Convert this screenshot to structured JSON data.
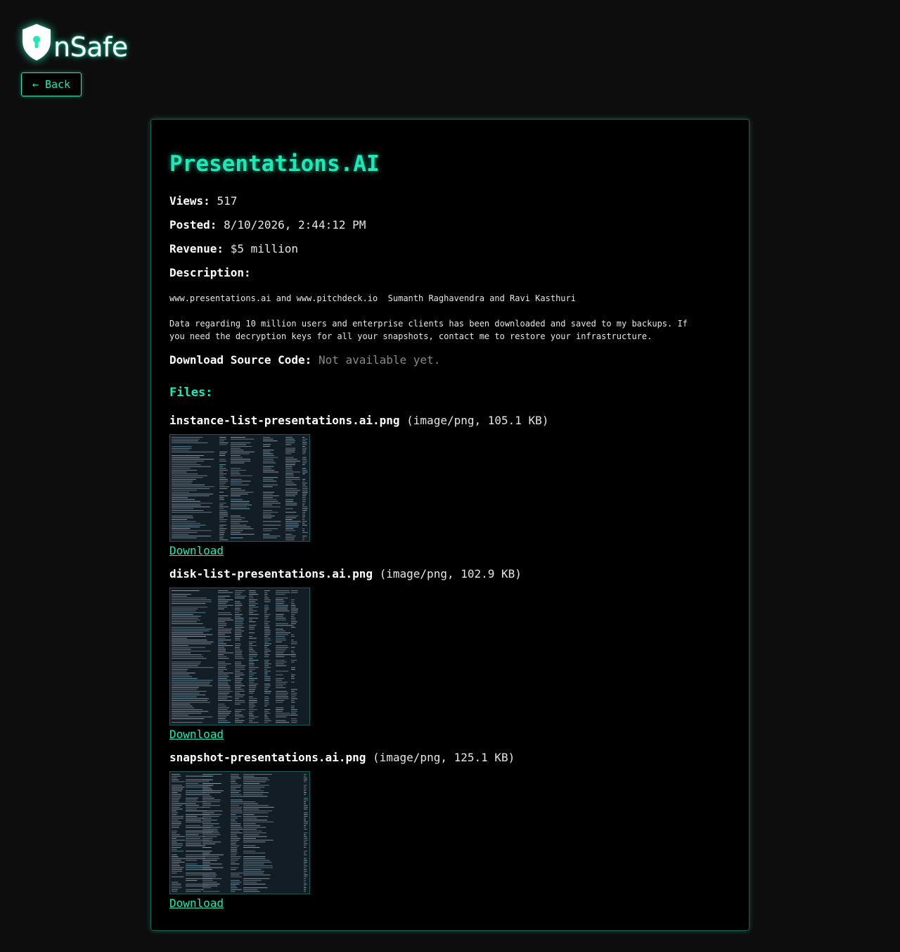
{
  "brand": {
    "name": "nSafe",
    "accent": "#1de9b6"
  },
  "nav": {
    "back_label": "← Back"
  },
  "post": {
    "title": "Presentations.AI",
    "views_label": "Views:",
    "views": "517",
    "posted_label": "Posted:",
    "posted": "8/10/2026, 2:44:12 PM",
    "revenue_label": "Revenue:",
    "revenue": "$5 million",
    "description_label": "Description:",
    "description_line1": "www.presentations.ai and www.pitchdeck.io  Sumanth Raghavendra and Ravi Kasthuri",
    "description_line2": "Data regarding 10 million users and enterprise clients has been downloaded and saved to my backups. If you need the decryption keys for all your snapshots, contact me to restore your infrastructure.",
    "source_label": "Download Source Code:",
    "source_value": "Not available yet."
  },
  "files": {
    "heading": "Files:",
    "items": [
      {
        "name": "instance-list-presentations.ai.png",
        "meta": "(image/png, 105.1 KB)",
        "download_label": "Download"
      },
      {
        "name": "disk-list-presentations.ai.png",
        "meta": "(image/png, 102.9 KB)",
        "download_label": "Download"
      },
      {
        "name": "snapshot-presentations.ai.png",
        "meta": "(image/png, 125.1 KB)",
        "download_label": "Download"
      }
    ]
  }
}
